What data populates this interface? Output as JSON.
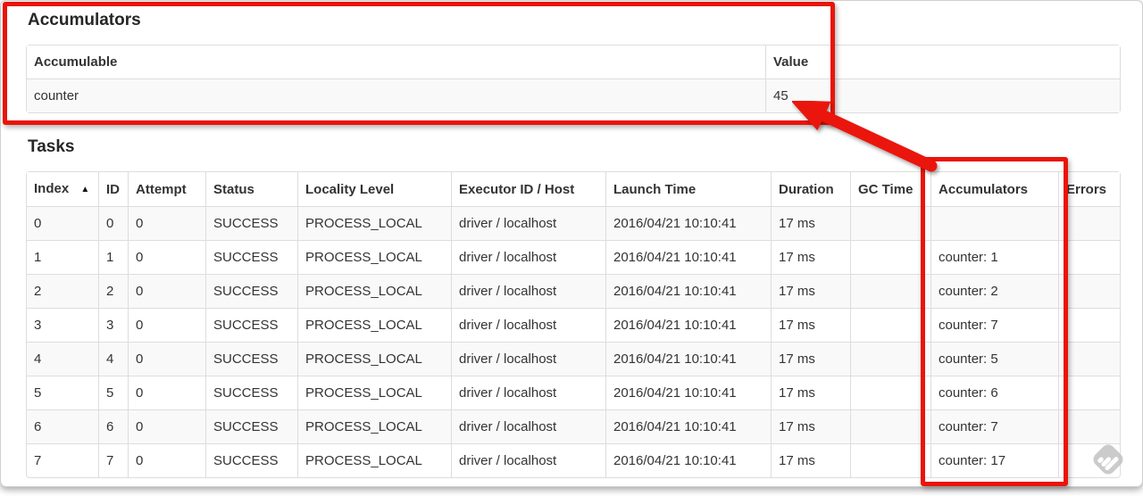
{
  "accumulators": {
    "title": "Accumulators",
    "col_accumulable": "Accumulable",
    "col_value": "Value",
    "rows": [
      {
        "accumulable": "counter",
        "value": "45"
      }
    ]
  },
  "tasks": {
    "title": "Tasks",
    "headers": {
      "index": "Index",
      "sort_indicator": "▲",
      "id": "ID",
      "attempt": "Attempt",
      "status": "Status",
      "locality": "Locality Level",
      "executor": "Executor ID / Host",
      "launch": "Launch Time",
      "duration": "Duration",
      "gc": "GC Time",
      "accumulators": "Accumulators",
      "errors": "Errors"
    },
    "column_order": [
      "index",
      "id",
      "attempt",
      "status",
      "locality",
      "executor",
      "launch",
      "duration",
      "gc",
      "accumulators",
      "errors"
    ],
    "rows": [
      {
        "index": "0",
        "id": "0",
        "attempt": "0",
        "status": "SUCCESS",
        "locality": "PROCESS_LOCAL",
        "executor": "driver / localhost",
        "launch": "2016/04/21 10:10:41",
        "duration": "17 ms",
        "gc": "",
        "accumulators": "",
        "errors": ""
      },
      {
        "index": "1",
        "id": "1",
        "attempt": "0",
        "status": "SUCCESS",
        "locality": "PROCESS_LOCAL",
        "executor": "driver / localhost",
        "launch": "2016/04/21 10:10:41",
        "duration": "17 ms",
        "gc": "",
        "accumulators": "counter: 1",
        "errors": ""
      },
      {
        "index": "2",
        "id": "2",
        "attempt": "0",
        "status": "SUCCESS",
        "locality": "PROCESS_LOCAL",
        "executor": "driver / localhost",
        "launch": "2016/04/21 10:10:41",
        "duration": "17 ms",
        "gc": "",
        "accumulators": "counter: 2",
        "errors": ""
      },
      {
        "index": "3",
        "id": "3",
        "attempt": "0",
        "status": "SUCCESS",
        "locality": "PROCESS_LOCAL",
        "executor": "driver / localhost",
        "launch": "2016/04/21 10:10:41",
        "duration": "17 ms",
        "gc": "",
        "accumulators": "counter: 7",
        "errors": ""
      },
      {
        "index": "4",
        "id": "4",
        "attempt": "0",
        "status": "SUCCESS",
        "locality": "PROCESS_LOCAL",
        "executor": "driver / localhost",
        "launch": "2016/04/21 10:10:41",
        "duration": "17 ms",
        "gc": "",
        "accumulators": "counter: 5",
        "errors": ""
      },
      {
        "index": "5",
        "id": "5",
        "attempt": "0",
        "status": "SUCCESS",
        "locality": "PROCESS_LOCAL",
        "executor": "driver / localhost",
        "launch": "2016/04/21 10:10:41",
        "duration": "17 ms",
        "gc": "",
        "accumulators": "counter: 6",
        "errors": ""
      },
      {
        "index": "6",
        "id": "6",
        "attempt": "0",
        "status": "SUCCESS",
        "locality": "PROCESS_LOCAL",
        "executor": "driver / localhost",
        "launch": "2016/04/21 10:10:41",
        "duration": "17 ms",
        "gc": "",
        "accumulators": "counter: 7",
        "errors": ""
      },
      {
        "index": "7",
        "id": "7",
        "attempt": "0",
        "status": "SUCCESS",
        "locality": "PROCESS_LOCAL",
        "executor": "driver / localhost",
        "launch": "2016/04/21 10:10:41",
        "duration": "17 ms",
        "gc": "",
        "accumulators": "counter: 17",
        "errors": ""
      }
    ]
  },
  "annotation": {
    "color": "#ea1408"
  }
}
